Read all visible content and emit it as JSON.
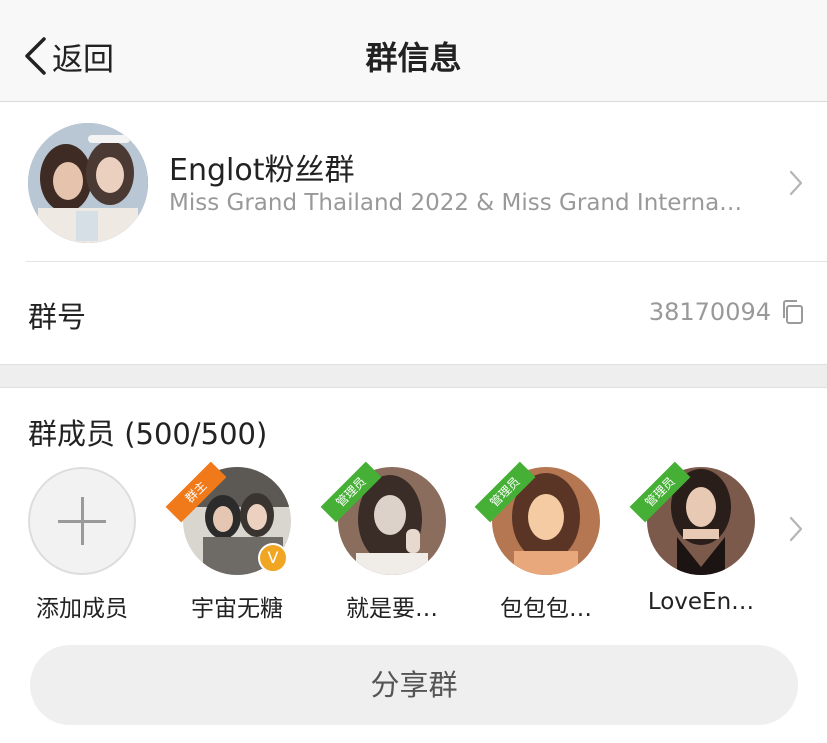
{
  "nav": {
    "back_label": "返回",
    "title": "群信息"
  },
  "group": {
    "name": "Englot粉丝群",
    "description": "Miss Grand Thailand 2022 & Miss Grand Internat…"
  },
  "group_number": {
    "label": "群号",
    "value": "38170094"
  },
  "members": {
    "title": "群成员 (500/500)",
    "add_label": "添加成员",
    "items": [
      {
        "name": "宇宙无糖",
        "role": "群主",
        "role_color": "#f07a1a",
        "verified": true,
        "verified_mark": "V",
        "colors": [
          "#2b2b2b",
          "#d9d6d0",
          "#6e6a66"
        ]
      },
      {
        "name": "就是要…",
        "role": "管理员",
        "role_color": "#45b035",
        "verified": false,
        "colors": [
          "#3a2c26",
          "#ddd2c9",
          "#8a6d5d"
        ]
      },
      {
        "name": "包包包…",
        "role": "管理员",
        "role_color": "#45b035",
        "verified": false,
        "colors": [
          "#b57752",
          "#f4cba2",
          "#5a3526"
        ]
      },
      {
        "name": "LoveEn…",
        "role": "管理员",
        "role_color": "#45b035",
        "verified": false,
        "colors": [
          "#2a1e1a",
          "#e8c9b3",
          "#7b5a4c"
        ]
      }
    ]
  },
  "share_label": "分享群"
}
